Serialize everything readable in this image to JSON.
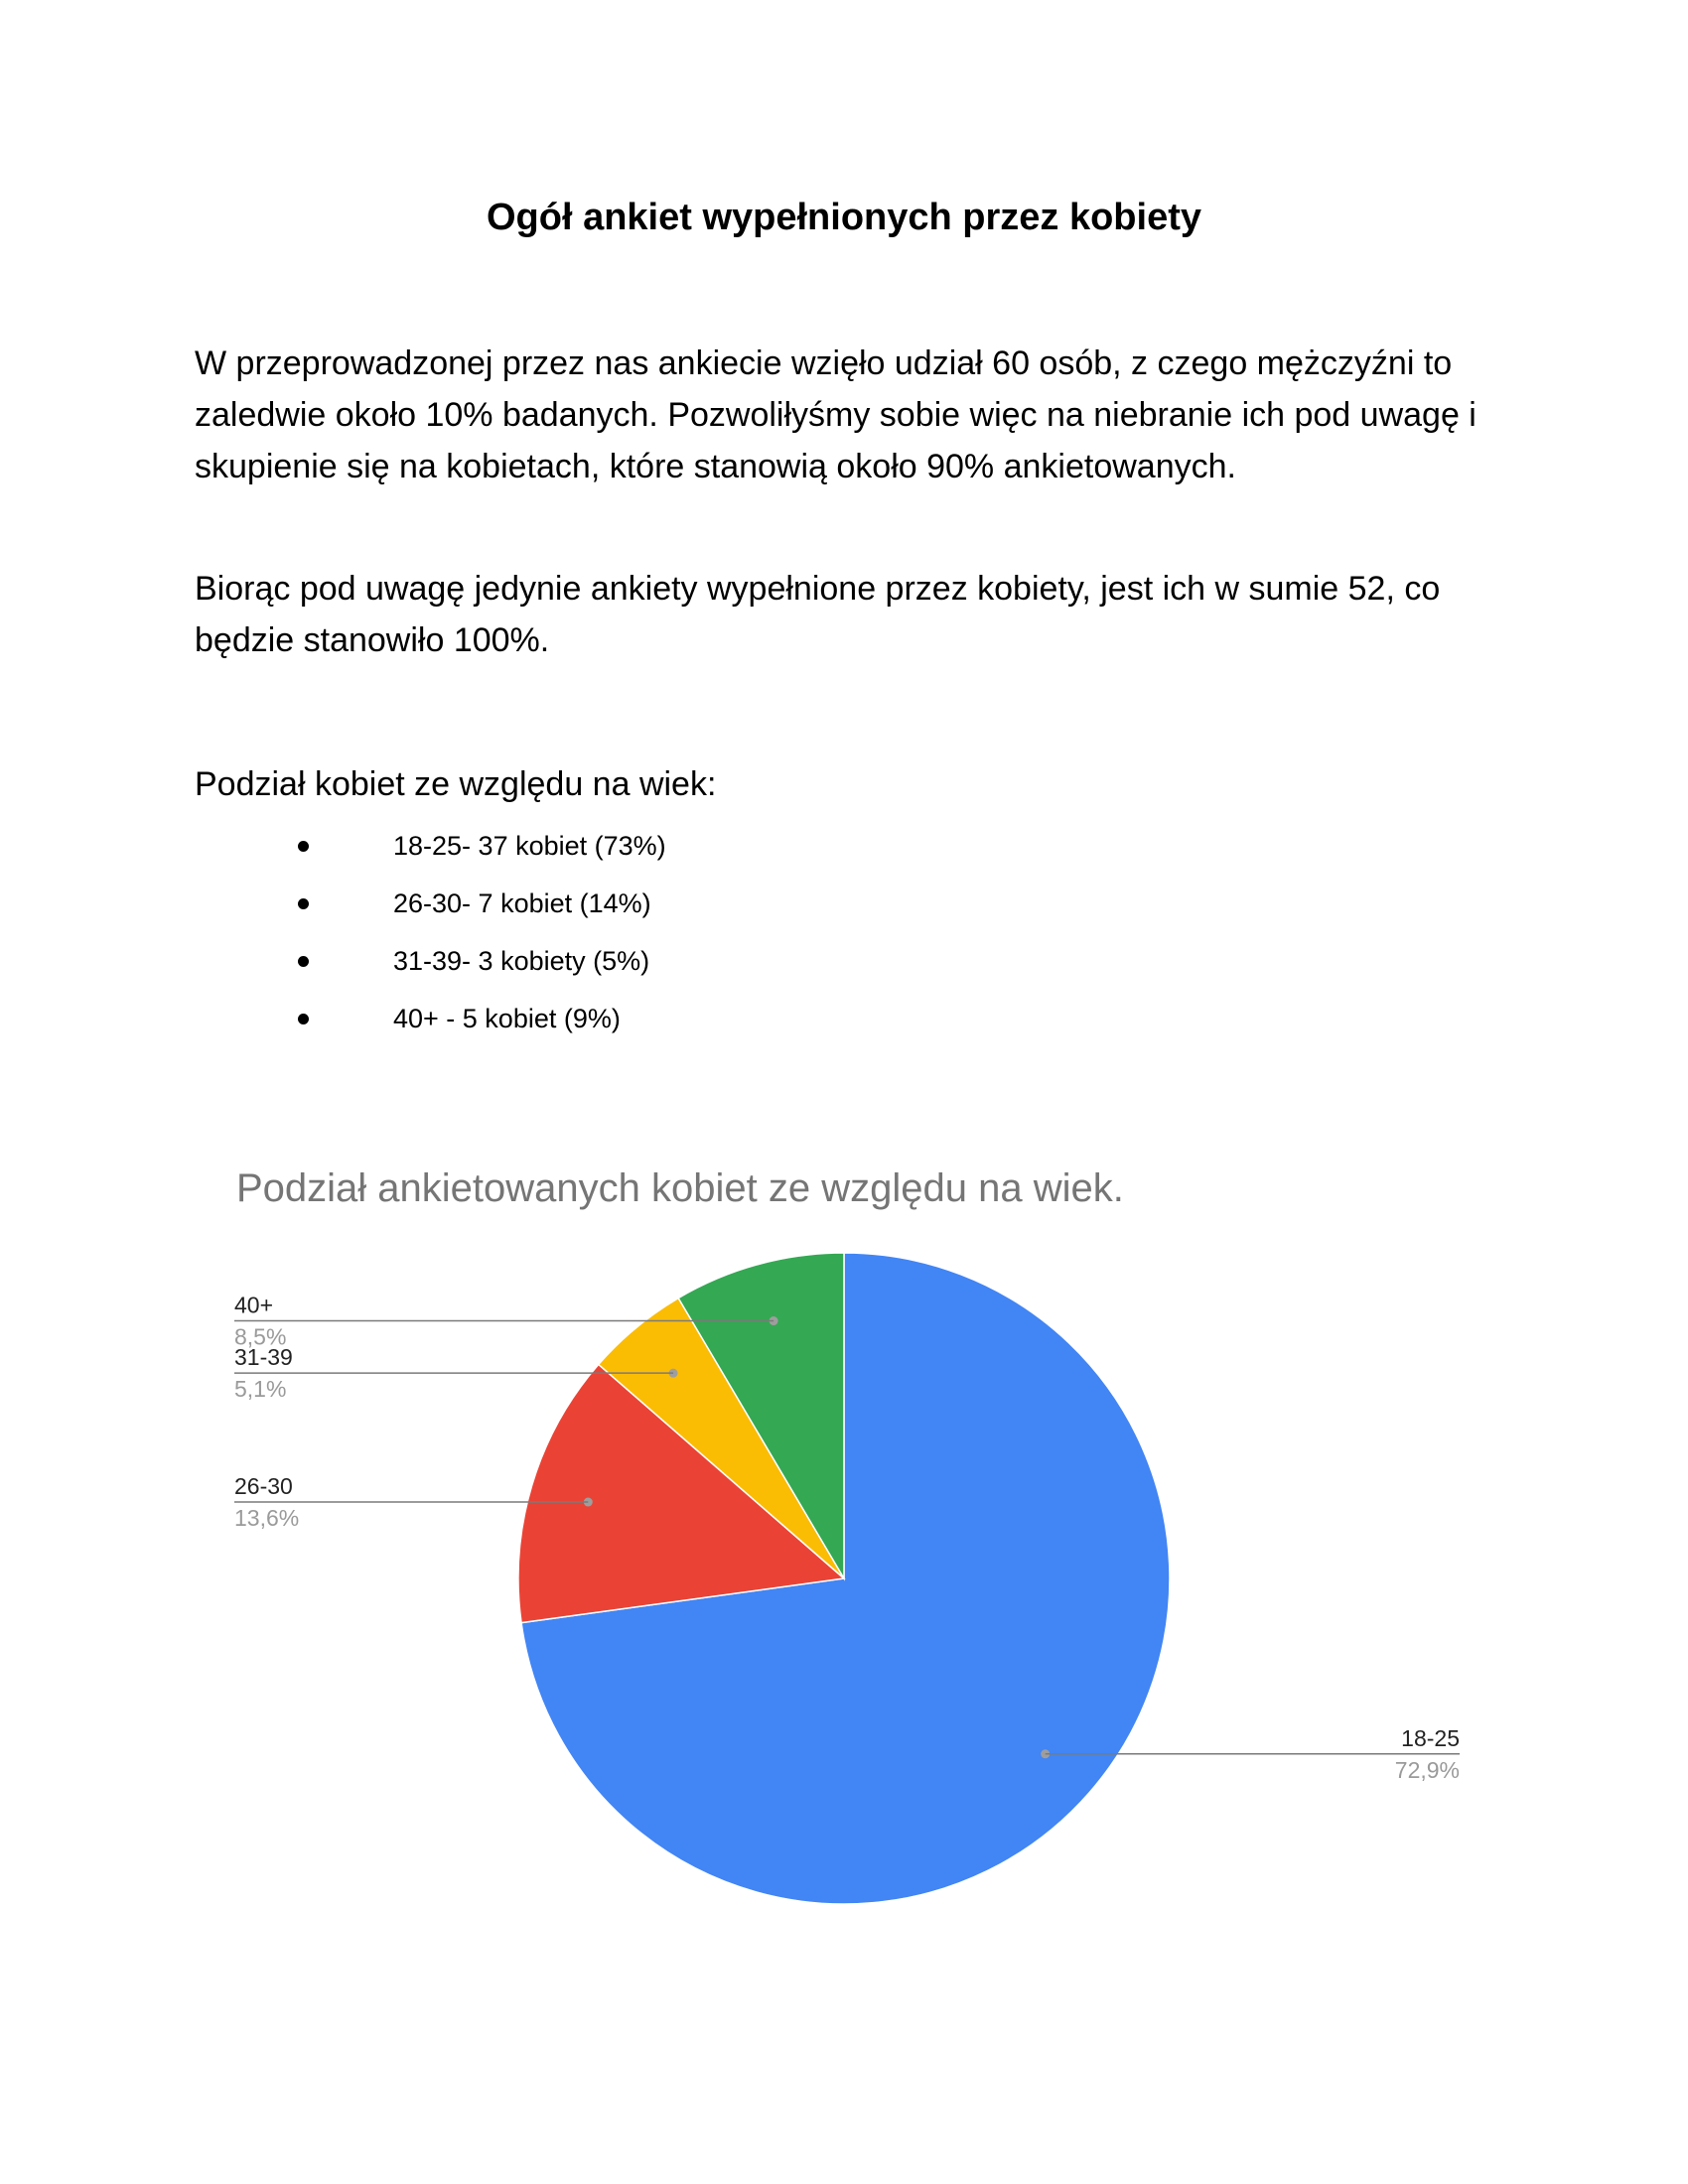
{
  "document": {
    "title": "Ogół ankiet wypełnionych przez kobiety",
    "paragraph_1": "W przeprowadzonej przez nas ankiecie wzięło udział 60 osób, z czego mężczyźni to zaledwie około 10% badanych. Pozwoliłyśmy sobie więc na niebranie ich pod uwagę i skupienie się na kobietach, które stanowią około 90% ankietowanych.",
    "paragraph_2": "Biorąc pod uwagę jedynie ankiety wypełnione przez kobiety, jest ich w sumie 52, co będzie stanowiło 100%.",
    "list_heading": "Podział kobiet ze względu na wiek:",
    "age_list": [
      "18-25- 37 kobiet (73%)",
      "26-30- 7 kobiet (14%)",
      "31-39- 3 kobiety (5%)",
      "40+ - 5 kobiet (9%)"
    ]
  },
  "chart_data": {
    "type": "pie",
    "title": "Podział ankietowanych kobiet ze względu na wiek.",
    "categories": [
      "18-25",
      "26-30",
      "31-39",
      "40+"
    ],
    "values": [
      72.9,
      13.6,
      5.1,
      8.5
    ],
    "value_labels": [
      "72,9%",
      "13,6%",
      "5,1%",
      "8,5%"
    ],
    "colors": [
      "#4285f4",
      "#ea4335",
      "#fbbc04",
      "#34a853"
    ],
    "start": "top, clockwise",
    "legend": "callout labels beside slices"
  }
}
